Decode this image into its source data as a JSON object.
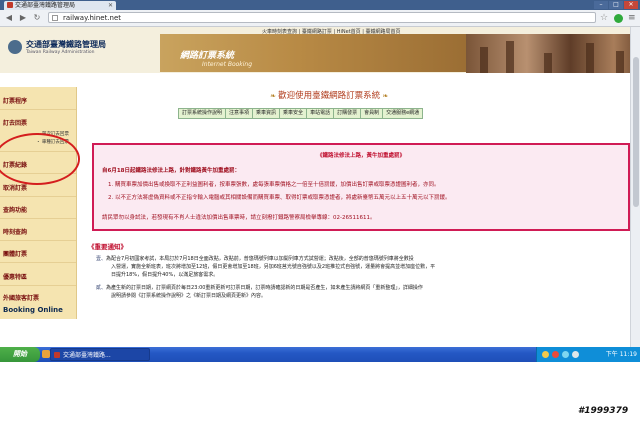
{
  "browser": {
    "tab_title": "交通部臺灣鐵路管理局",
    "url": "railway.hinet.net"
  },
  "header": {
    "org_name": "交通部臺灣鐵路管理局",
    "org_name_en": "Taiwan Railway Administration",
    "top_links": "火車時刻表查詢 | 臺鐵網路訂票 | HiNet首頁 | 臺鐵網路局首頁",
    "banner_title": "網路訂票系統",
    "banner_subtitle": "Internet Booking"
  },
  "sidebar": {
    "items": [
      {
        "label": "訂票程序"
      },
      {
        "label": "訂去回票"
      },
      {
        "label": "訂票紀錄"
      },
      {
        "label": "取消訂票"
      },
      {
        "label": "查詢功能"
      },
      {
        "label": "時刻查詢"
      },
      {
        "label": "團體訂票"
      },
      {
        "label": "優惠特區"
      },
      {
        "label": "外國旅客訂票"
      }
    ],
    "sub_items": [
      {
        "label": "・ 單次訂去回票"
      },
      {
        "label": "・ 車種訂去回票"
      }
    ],
    "booking_online": "Booking Online"
  },
  "main": {
    "welcome_title": "歡迎使用臺鐵網路訂票系統",
    "menu": [
      {
        "label": "訂票系統操作說明"
      },
      {
        "label": "注意事項"
      },
      {
        "label": "乘車資訊"
      },
      {
        "label": "乘車安全"
      },
      {
        "label": "車站電話"
      },
      {
        "label": "訂購發票"
      },
      {
        "label": "會員制"
      },
      {
        "label": "交通服務e網通"
      }
    ],
    "notice": {
      "title": "《鐵路法修法上路，黃牛加重處罰》",
      "intro": "自6月18日起鐵路法修法上路，針對鐵路黃牛加重處罰：",
      "point1": "1. 購買車票加價出售或換取不正利益圖利者，按車票張數，處每張車票價格之一倍至十倍罰鍰，加價出售訂票或取票憑證圖利者，亦同。",
      "point2": "2. 以不正方法將虛偽資料或不正指令輸入電腦或其相關設備而購買車票、取得訂票或取票憑證者，將處新臺幣五萬元以上五十萬元以下罰鍰。",
      "closing": "請民眾勿以身試法，若發現有不肖人士違法加價出售車票時，請立刻撥打鐵路警察局檢舉專線：02-26511611。"
    },
    "important_title": "《重要通知》",
    "important": [
      {
        "label": "壹、",
        "line1": "為配合7月初國家考試，本局訂於7月18日全面改點，改點前，普悠瑪號列車以加開列車方式試營運；改點後，全部的普悠瑪號列車將全數投",
        "line2": "入營運，實施全新班表，班次將增加至12班，假日更會增加至18班，另加6班莒光號自強號以及2班推拉式自強號，運量將會提高並增加座位數，平",
        "line3": "日提升18%，假日提升40%，以滿足旅客需求。"
      },
      {
        "label": "貳、",
        "line1": "為產生新的訂票日期，訂票網頁於每日23:00重新更新可訂票日期，訂票時請確認新的日期是否產生，如未產生請將網頁「重新整理」，詳細操作",
        "line2": "說明請參閱《訂票系統操作說明》之《新訂票日期及網頁更新》內容。"
      }
    ]
  },
  "taskbar": {
    "start_label": "開始",
    "task_item": "交通部臺灣鐵路...",
    "clock": "下午 11:19"
  },
  "watermark": "#1999379"
}
